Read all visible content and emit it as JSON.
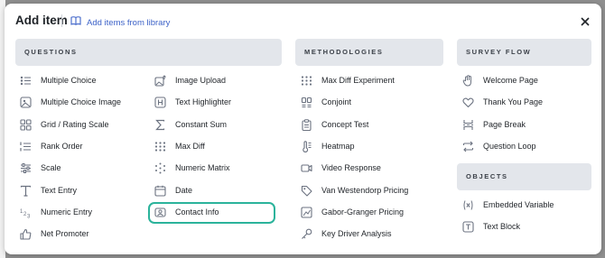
{
  "header": {
    "title": "Add item",
    "library_link": "Add items from library"
  },
  "colors": {
    "accent": "#3e63c8",
    "highlight": "#2bb39b",
    "section_bg": "#e3e6eb"
  },
  "sections": {
    "questions": "QUESTIONS",
    "methodologies": "METHODOLOGIES",
    "survey_flow": "SURVEY FLOW",
    "objects": "OBJECTS"
  },
  "questions_col1": [
    {
      "label": "Multiple Choice",
      "icon": "list-bullets-icon"
    },
    {
      "label": "Multiple Choice Image",
      "icon": "image-choice-icon"
    },
    {
      "label": "Grid / Rating Scale",
      "icon": "grid-icon"
    },
    {
      "label": "Rank Order",
      "icon": "rank-list-icon"
    },
    {
      "label": "Scale",
      "icon": "sliders-icon"
    },
    {
      "label": "Text Entry",
      "icon": "text-t-icon"
    },
    {
      "label": "Numeric Entry",
      "icon": "numbers-icon"
    },
    {
      "label": "Net Promoter",
      "icon": "thumbs-up-icon"
    }
  ],
  "questions_col2": [
    {
      "label": "Image Upload",
      "icon": "image-upload-icon"
    },
    {
      "label": "Text Highlighter",
      "icon": "highlighter-icon"
    },
    {
      "label": "Constant Sum",
      "icon": "sigma-icon"
    },
    {
      "label": "Max Diff",
      "icon": "dots-grid-icon"
    },
    {
      "label": "Numeric Matrix",
      "icon": "matrix-icon"
    },
    {
      "label": "Date",
      "icon": "calendar-icon"
    },
    {
      "label": "Contact Info",
      "icon": "contact-card-icon"
    }
  ],
  "methodologies": [
    {
      "label": "Max Diff Experiment",
      "icon": "dots-grid-icon"
    },
    {
      "label": "Conjoint",
      "icon": "columns-icon"
    },
    {
      "label": "Concept Test",
      "icon": "clipboard-icon"
    },
    {
      "label": "Heatmap",
      "icon": "thermometer-icon"
    },
    {
      "label": "Video Response",
      "icon": "video-icon"
    },
    {
      "label": "Van Westendorp Pricing",
      "icon": "price-tag-icon"
    },
    {
      "label": "Gabor-Granger Pricing",
      "icon": "pricing-box-icon"
    },
    {
      "label": "Key Driver Analysis",
      "icon": "key-icon"
    }
  ],
  "survey_flow": [
    {
      "label": "Welcome Page",
      "icon": "wave-hand-icon"
    },
    {
      "label": "Thank You Page",
      "icon": "heart-icon"
    },
    {
      "label": "Page Break",
      "icon": "page-break-icon"
    },
    {
      "label": "Question Loop",
      "icon": "loop-icon"
    }
  ],
  "objects": [
    {
      "label": "Embedded Variable",
      "icon": "variable-x-icon"
    },
    {
      "label": "Text Block",
      "icon": "text-block-icon"
    }
  ]
}
